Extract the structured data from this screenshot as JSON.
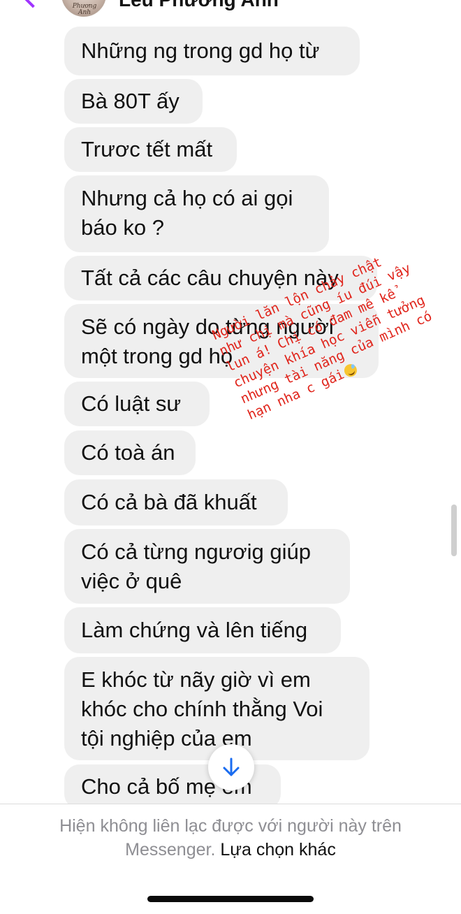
{
  "header": {
    "contact_name": "Lều Phương Anh",
    "avatar_text": "Phương Anh"
  },
  "messages": [
    "Những ng trong gd họ từ",
    "Bà 80T ấy",
    "Trươc tết mất",
    "Nhưng cả họ có ai gọi\nbáo ko ?",
    "Tất cả các câu chuyện này",
    "Sẽ có ngày do từng người\nmột trong gd họ",
    "Có luật sư",
    "Có toà án",
    "Có cả bà đã khuất",
    "Có cả từng ngươig giúp\nviệc ở quê",
    "Làm chứng và lên tiếng",
    "E khóc từ nãy giờ vì em\nkhóc cho chính thằng Voi\ntội nghiệp của em",
    "Cho cả bố mẹ em"
  ],
  "annotation": {
    "lines": [
      "Người lăn lộn chảy chật",
      "như chị mà cũng íu đúi vậy",
      "lun á! Chị có đam mê kể",
      "chuyện khía học viễn tưởng",
      "nhưng tài năng của mình có",
      "hạn nha c gái"
    ],
    "emoji": "sweat-smile-emoji",
    "color": "#e0241b"
  },
  "footer": {
    "notice": "Hiện không liên lạc được với người này trên",
    "notice_line2": "Messenger.",
    "link": "Lựa chọn khác"
  },
  "colors": {
    "bubble": "#efefef",
    "accent": "#a033ff",
    "muted_text": "#8e8e93"
  }
}
